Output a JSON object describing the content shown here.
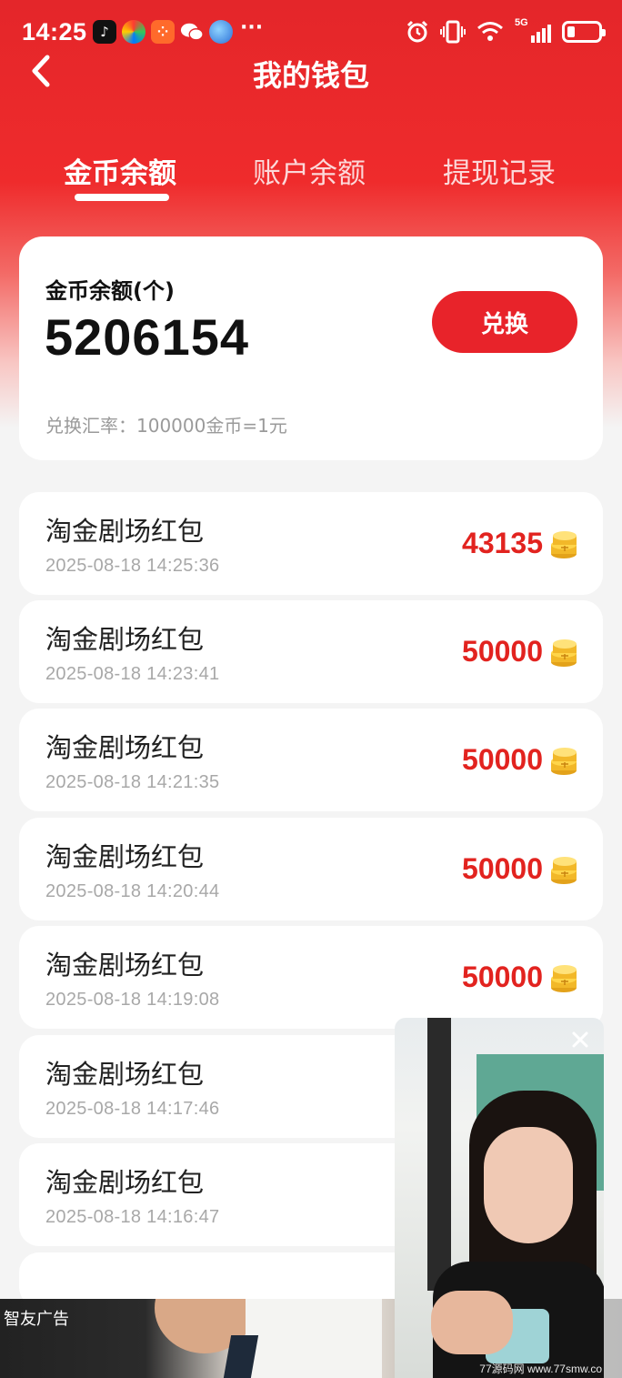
{
  "status_bar": {
    "time": "14:25",
    "more": "···",
    "network": "5G"
  },
  "header": {
    "title": "我的钱包"
  },
  "tabs": [
    {
      "label": "金币余额",
      "active": true
    },
    {
      "label": "账户余额",
      "active": false
    },
    {
      "label": "提现记录",
      "active": false
    }
  ],
  "balance_card": {
    "label": "金币余额(个)",
    "value": "5206154",
    "button_label": "兑换",
    "rate_text": "兑换汇率：100000金币=1元"
  },
  "records": [
    {
      "title": "淘金剧场红包",
      "time": "2025-08-18 14:25:36",
      "amount": "43135"
    },
    {
      "title": "淘金剧场红包",
      "time": "2025-08-18 14:23:41",
      "amount": "50000"
    },
    {
      "title": "淘金剧场红包",
      "time": "2025-08-18 14:21:35",
      "amount": "50000"
    },
    {
      "title": "淘金剧场红包",
      "time": "2025-08-18 14:20:44",
      "amount": "50000"
    },
    {
      "title": "淘金剧场红包",
      "time": "2025-08-18 14:19:08",
      "amount": "50000"
    },
    {
      "title": "淘金剧场红包",
      "time": "2025-08-18 14:17:46",
      "amount": ""
    },
    {
      "title": "淘金剧场红包",
      "time": "2025-08-18 14:16:47",
      "amount": ""
    }
  ],
  "ad": {
    "label": "智友广告"
  },
  "watermark": "77源码网 www.77smw.co",
  "colors": {
    "brand_red": "#e8232a",
    "amount_red": "#e2231f"
  }
}
